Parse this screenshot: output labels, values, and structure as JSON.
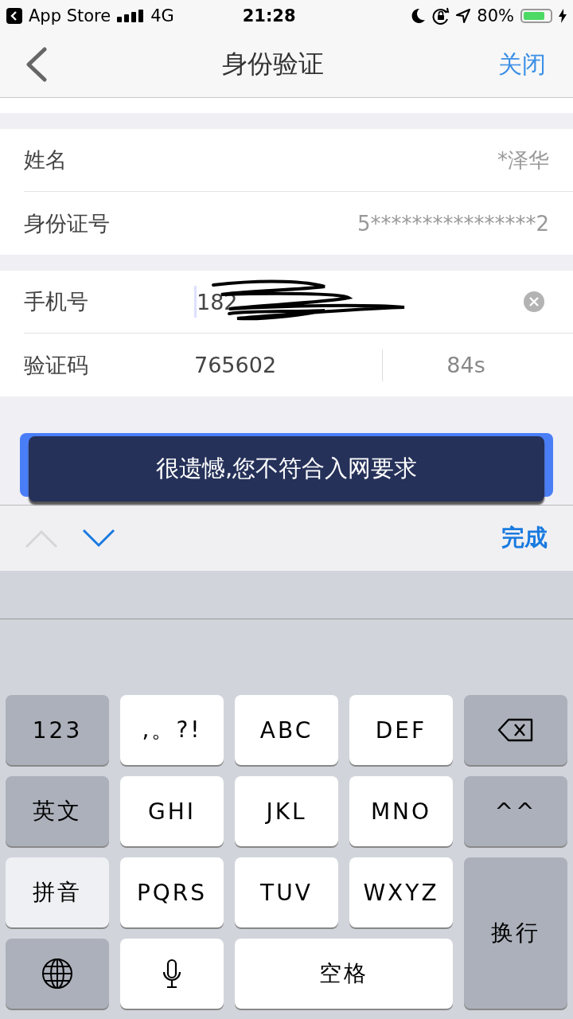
{
  "status_bar": {
    "back_app": "App Store",
    "network": "4G",
    "time": "21:28",
    "battery_text": "80%",
    "battery": {
      "level": 0.8,
      "charging": true
    }
  },
  "nav": {
    "title": "身份验证",
    "close": "关闭"
  },
  "info_rows": [
    {
      "label": "姓名",
      "value": "*泽华"
    },
    {
      "label": "身份证号",
      "value": "5****************2"
    }
  ],
  "phone": {
    "label": "手机号",
    "value": "182",
    "redacted": true
  },
  "code": {
    "label": "验证码",
    "value": "765602",
    "countdown": "84s"
  },
  "toast": {
    "text": "很遗憾,您不符合入网要求"
  },
  "toolbar": {
    "prev": {
      "disabled": true
    },
    "next": {
      "disabled": false
    },
    "done": "完成"
  },
  "keys": [
    {
      "kind": "function",
      "label": "123",
      "selected": false
    },
    {
      "kind": "letter",
      "label": ",。?!",
      "selected": false
    },
    {
      "kind": "letter",
      "label": "ABC",
      "selected": false
    },
    {
      "kind": "letter",
      "label": "DEF",
      "selected": false
    },
    {
      "kind": "delete",
      "selected": false
    },
    {
      "kind": "function",
      "label": "英文",
      "selected": false
    },
    {
      "kind": "letter",
      "label": "GHI",
      "selected": false
    },
    {
      "kind": "letter",
      "label": "JKL",
      "selected": false
    },
    {
      "kind": "letter",
      "label": "MNO",
      "selected": false
    },
    {
      "kind": "function",
      "label": "^^",
      "selected": false
    },
    {
      "kind": "function",
      "label": "拼音",
      "selected": true
    },
    {
      "kind": "letter",
      "label": "PQRS",
      "selected": false
    },
    {
      "kind": "letter",
      "label": "TUV",
      "selected": false
    },
    {
      "kind": "letter",
      "label": "WXYZ",
      "selected": false
    },
    {
      "kind": "return",
      "label": "换行",
      "selected": false
    },
    {
      "kind": "globe",
      "selected": false
    },
    {
      "kind": "mic",
      "selected": false
    },
    {
      "kind": "space",
      "label": "空格",
      "selected": false
    }
  ]
}
